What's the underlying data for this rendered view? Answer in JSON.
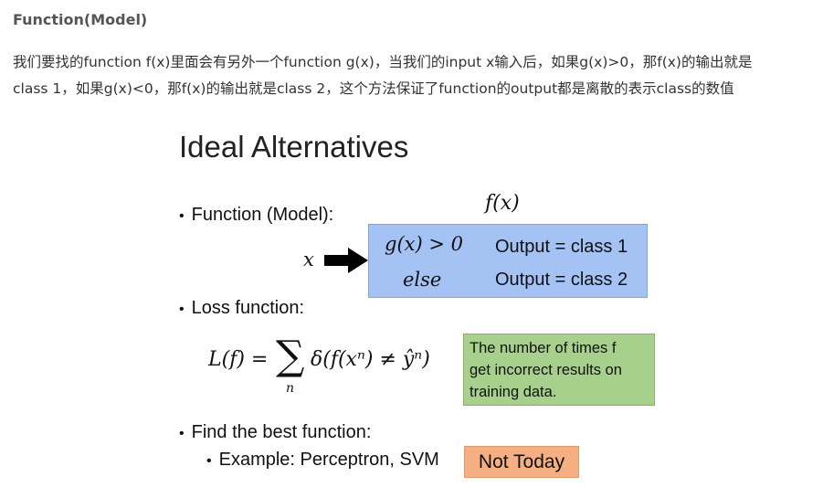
{
  "section_heading": "Function(Model)",
  "paragraph": {
    "line1": "我们要找的function f(x)里面会有另外一个function g(x)，当我们的input x输入后，如果g(x)>0，那f(x)的输出就是",
    "line2": "class 1，如果g(x)<0，那f(x)的输出就是class 2，这个方法保证了function的output都是离散的表示class的数值"
  },
  "slide": {
    "title": "Ideal Alternatives",
    "bullet_function": "Function (Model):",
    "fx_label": "f(x)",
    "x_label": "x",
    "condition": "g(x) > 0",
    "else_label": "else",
    "output1": "Output = class 1",
    "output2": "Output = class 2",
    "bullet_loss": "Loss function:",
    "loss_lhs": "L(f) =",
    "loss_sum_index": "n",
    "loss_rhs": "δ(f(xⁿ) ≠ ŷⁿ)",
    "loss_note_lines": [
      "The number of times f",
      "get incorrect results on",
      "training data."
    ],
    "bullet_find": "Find the best function:",
    "sub_bullet_example": "Example: Perceptron, SVM",
    "not_today": "Not Today"
  },
  "colors": {
    "blue_box": "#a4c2f4",
    "green_box": "#a8d08d",
    "orange_box": "#f4b083"
  }
}
